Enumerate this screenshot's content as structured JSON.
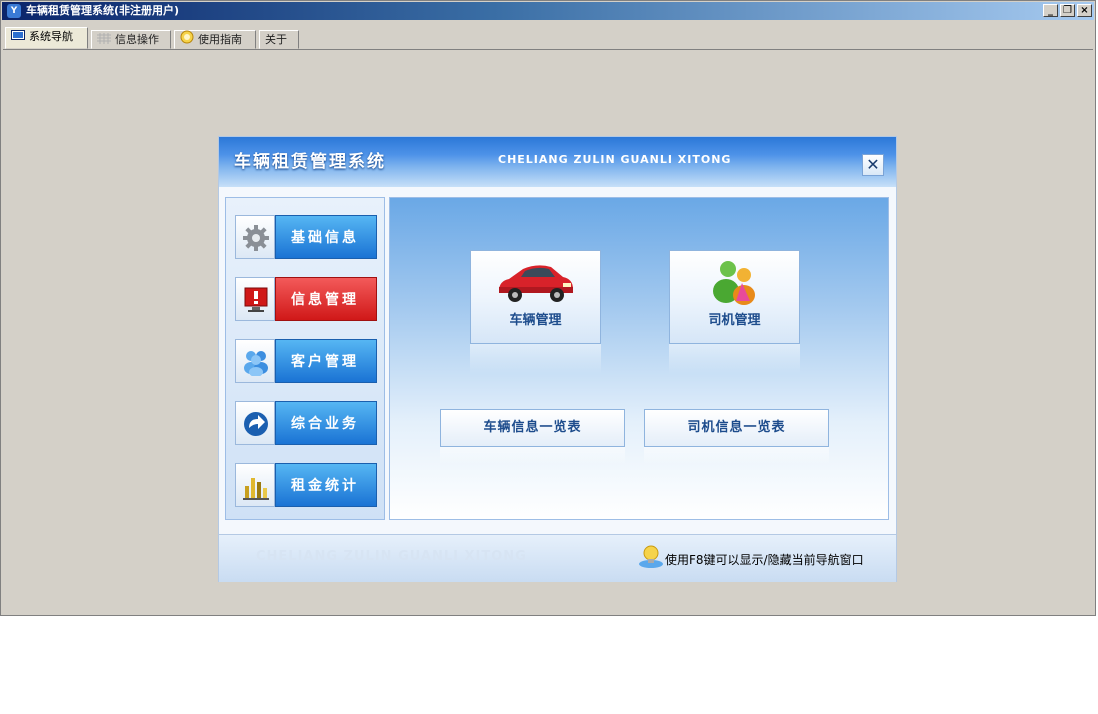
{
  "window": {
    "title": "车辆租赁管理系统(非注册用户)",
    "minimize_label": "_",
    "restore_label": "❐",
    "close_label": "×"
  },
  "tabs": [
    {
      "label": "系统导航",
      "active": true
    },
    {
      "label": "信息操作",
      "active": false
    },
    {
      "label": "使用指南",
      "active": false
    },
    {
      "label": "关于",
      "active": false
    }
  ],
  "panel": {
    "title": "车辆租赁管理系统",
    "subtitle": "CHELIANG ZULIN GUANLI XITONG",
    "close_label": "✕",
    "sidebar": [
      {
        "label": "基础信息",
        "icon": "gear-icon"
      },
      {
        "label": "信息管理",
        "icon": "alert-monitor-icon",
        "selected": true
      },
      {
        "label": "客户管理",
        "icon": "users-icon"
      },
      {
        "label": "综合业务",
        "icon": "arrow-icon"
      },
      {
        "label": "租金统计",
        "icon": "bar-chart-icon"
      }
    ],
    "main": {
      "vehicle_button": "车辆管理",
      "driver_button": "司机管理",
      "vehicle_list_button": "车辆信息一览表",
      "driver_list_button": "司机信息一览表"
    },
    "footer": {
      "watermark": "CHELIANG ZULIN GUANLI XITONG",
      "hint": "使用F8键可以显示/隐藏当前导航窗口"
    }
  },
  "colors": {
    "accent_blue": "#1a73d4",
    "selected_red": "#d01818",
    "title_bar": "#0a246a"
  }
}
